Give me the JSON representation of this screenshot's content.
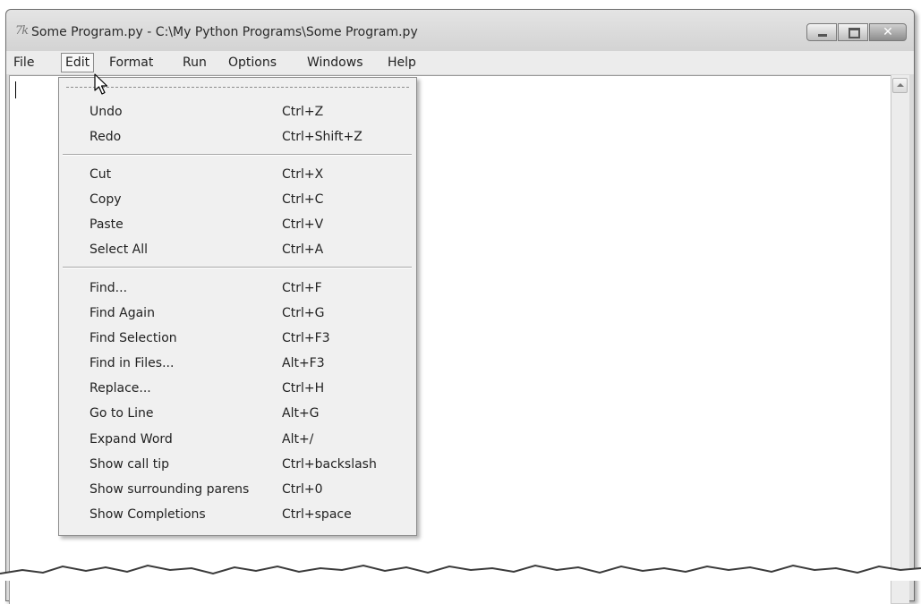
{
  "window": {
    "title": "Some Program.py - C:\\My Python Programs\\Some Program.py",
    "app_icon_glyph": "7k",
    "close_glyph": "✕"
  },
  "menubar": {
    "items": [
      "File",
      "Edit",
      "Format",
      "Run",
      "Options",
      "Windows",
      "Help"
    ],
    "active": "Edit"
  },
  "edit_menu": {
    "groups": [
      [
        {
          "label": "Undo",
          "accelerator": "Ctrl+Z"
        },
        {
          "label": "Redo",
          "accelerator": "Ctrl+Shift+Z"
        }
      ],
      [
        {
          "label": "Cut",
          "accelerator": "Ctrl+X"
        },
        {
          "label": "Copy",
          "accelerator": "Ctrl+C"
        },
        {
          "label": "Paste",
          "accelerator": "Ctrl+V"
        },
        {
          "label": "Select All",
          "accelerator": "Ctrl+A"
        }
      ],
      [
        {
          "label": "Find...",
          "accelerator": "Ctrl+F"
        },
        {
          "label": "Find Again",
          "accelerator": "Ctrl+G"
        },
        {
          "label": "Find Selection",
          "accelerator": "Ctrl+F3"
        },
        {
          "label": "Find in Files...",
          "accelerator": "Alt+F3"
        },
        {
          "label": "Replace...",
          "accelerator": "Ctrl+H"
        },
        {
          "label": "Go to Line",
          "accelerator": "Alt+G"
        },
        {
          "label": "Expand Word",
          "accelerator": "Alt+/"
        },
        {
          "label": "Show call tip",
          "accelerator": "Ctrl+backslash"
        },
        {
          "label": "Show surrounding parens",
          "accelerator": "Ctrl+0"
        },
        {
          "label": "Show Completions",
          "accelerator": "Ctrl+space"
        }
      ]
    ]
  },
  "colors": {
    "chrome": "#dadada",
    "menu_background": "#f0f0f0",
    "editor_background": "#ffffff",
    "text": "#222222"
  },
  "icons": [
    "app-icon",
    "minimize-icon",
    "maximize-icon",
    "close-icon",
    "scroll-up-arrow-icon",
    "mouse-pointer-icon"
  ]
}
